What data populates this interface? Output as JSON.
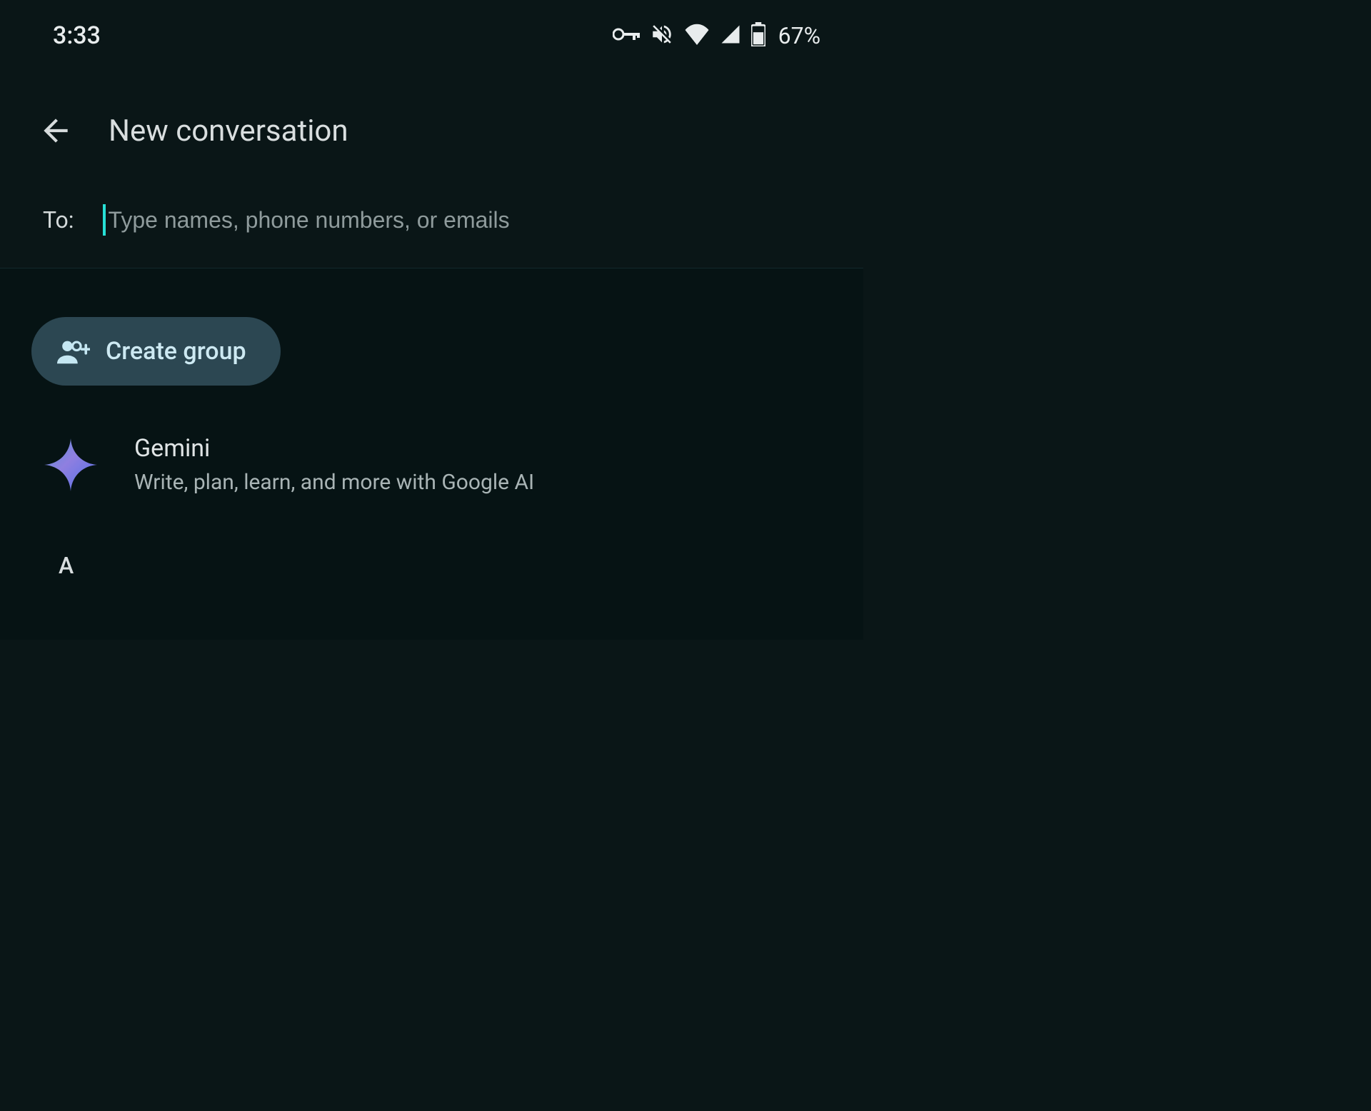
{
  "status": {
    "time": "3:33",
    "battery_pct": "67%"
  },
  "header": {
    "title": "New conversation"
  },
  "recipient": {
    "label": "To:",
    "placeholder": "Type names, phone numbers, or emails",
    "value": ""
  },
  "create_group": {
    "label": "Create group"
  },
  "gemini": {
    "title": "Gemini",
    "subtitle": "Write, plan, learn, and more with Google AI"
  },
  "sections": {
    "first_letter": "A"
  }
}
